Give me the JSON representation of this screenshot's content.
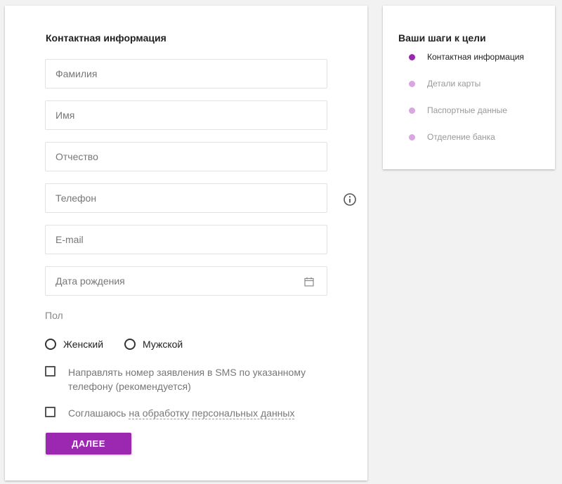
{
  "form": {
    "title": "Контактная информация",
    "fields": {
      "last_name": {
        "placeholder": "Фамилия",
        "value": ""
      },
      "first_name": {
        "placeholder": "Имя",
        "value": ""
      },
      "middle_name": {
        "placeholder": "Отчество",
        "value": ""
      },
      "phone": {
        "placeholder": "Телефон",
        "value": ""
      },
      "email": {
        "placeholder": "E-mail",
        "value": ""
      },
      "birth_date": {
        "placeholder": "Дата рождения",
        "value": ""
      }
    },
    "gender": {
      "label": "Пол",
      "options": [
        "Женский",
        "Мужской"
      ],
      "selected": ""
    },
    "sms_checkbox": {
      "label": "Направлять номер заявления в SMS по указанному телефону (рекомендуется)",
      "checked": false
    },
    "consent_checkbox": {
      "prefix": "Соглашаюсь ",
      "link": "на обработку персональных данных",
      "checked": false
    },
    "next_button": "ДАЛЕЕ"
  },
  "steps": {
    "title": "Ваши шаги к цели",
    "items": [
      {
        "label": "Контактная информация",
        "active": true
      },
      {
        "label": "Детали карты",
        "active": false
      },
      {
        "label": "Паспортные данные",
        "active": false
      },
      {
        "label": "Отделение банка",
        "active": false
      }
    ]
  },
  "colors": {
    "accent": "#9c27b0",
    "step_active_dot": "#9c27b0",
    "step_inactive_dot": "#d9a6e2",
    "step_active_text": "#222222",
    "step_inactive_text": "#999999"
  },
  "icons": {
    "phone_info": "info-icon",
    "birth_date": "calendar-icon"
  }
}
